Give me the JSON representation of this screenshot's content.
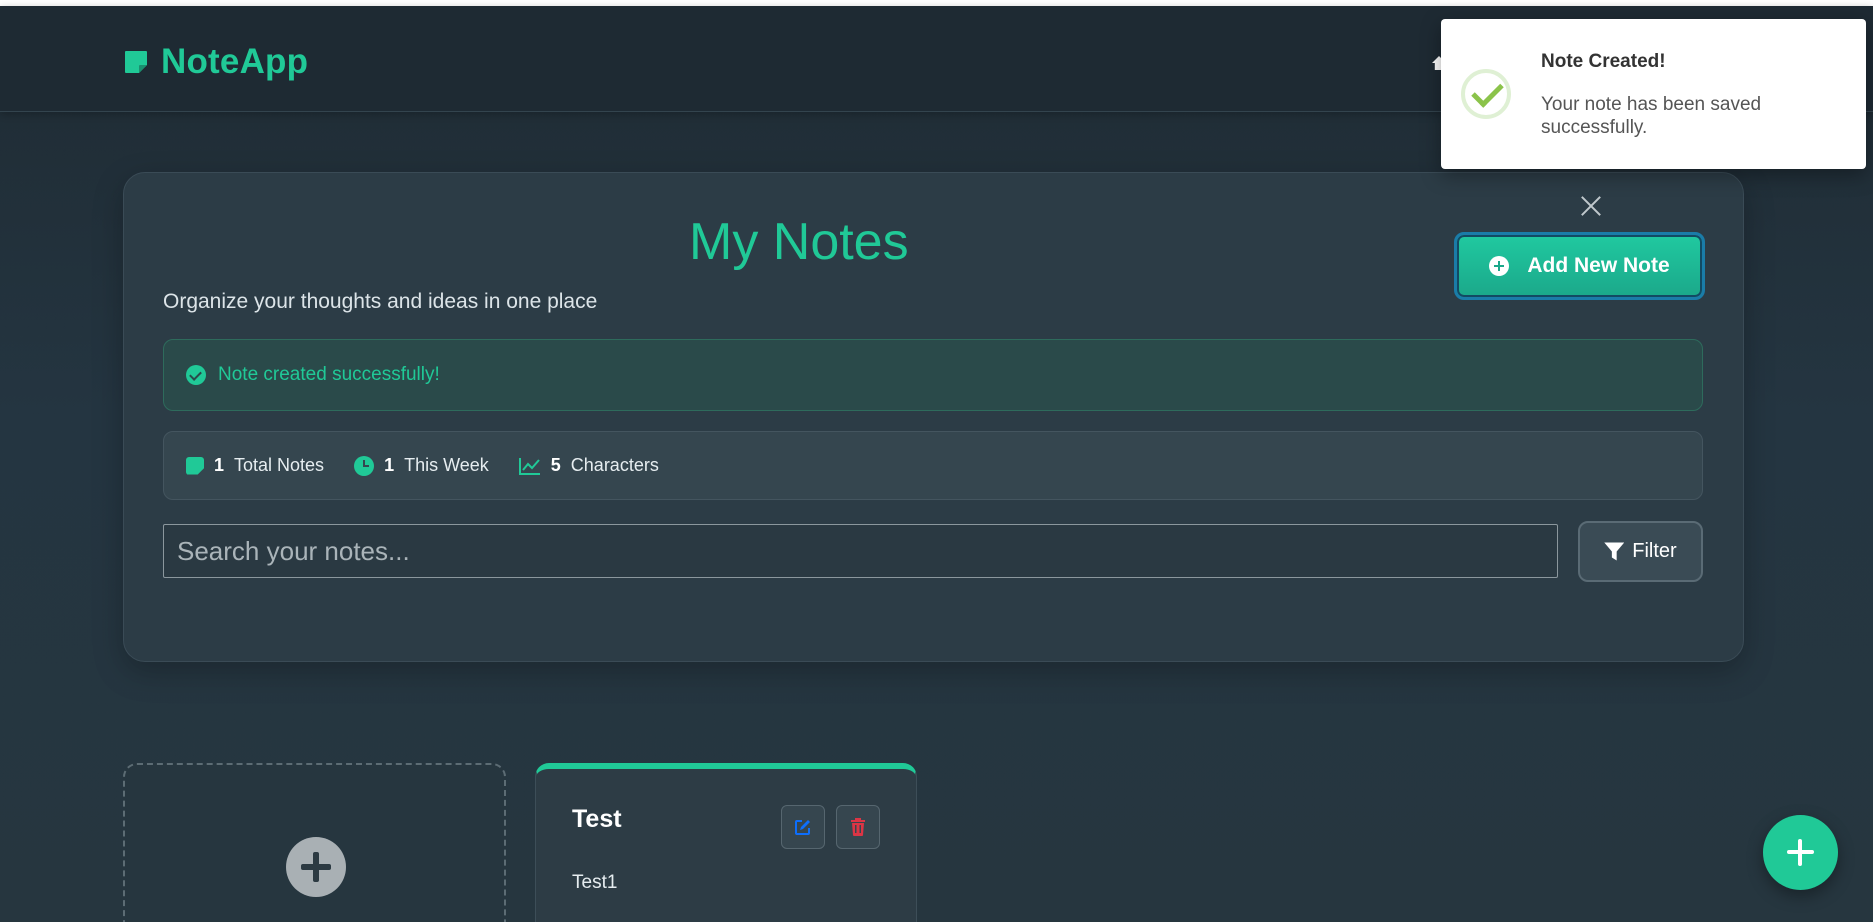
{
  "app": {
    "brand": "NoteApp"
  },
  "header": {
    "title": "My Notes",
    "subtitle": "Organize your thoughts and ideas in one place",
    "add_button_label": "Add New Note"
  },
  "alert": {
    "message": "Note created successfully!"
  },
  "stats": [
    {
      "value": "1",
      "label": "Total Notes",
      "icon": "note-icon"
    },
    {
      "value": "1",
      "label": "This Week",
      "icon": "clock-icon"
    },
    {
      "value": "5",
      "label": "Characters",
      "icon": "chart-icon"
    }
  ],
  "search": {
    "placeholder": "Search your notes...",
    "value": ""
  },
  "filter": {
    "label": "Filter"
  },
  "notes": [
    {
      "title": "Test",
      "body": "Test1"
    }
  ],
  "toast": {
    "title": "Note Created!",
    "message": "Your note has been saved successfully."
  },
  "colors": {
    "accent": "#20c997",
    "background": "#243541",
    "panel": "#2c3c46",
    "danger": "#dc3545",
    "edit": "#0d6efd"
  }
}
